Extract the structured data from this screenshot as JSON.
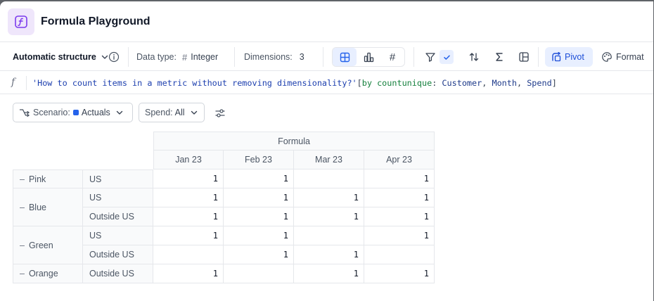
{
  "app": {
    "title": "Formula Playground",
    "icon": "formula-icon",
    "accent": "#7c3aed"
  },
  "toolbar": {
    "structure_label": "Automatic structure",
    "data_type_label": "Data type:",
    "data_type_value": "Integer",
    "dimensions_label": "Dimensions:",
    "dimensions_value": "3",
    "pivot_label": "Pivot",
    "format_label": "Format",
    "active_color": "#2563eb"
  },
  "formula": {
    "string_part": "'How to count items in a metric without removing dimensionality?'",
    "open_bracket": "[",
    "keyword": "by countunique",
    "colon": ":",
    "dims": [
      "Customer",
      "Month",
      "Spend"
    ],
    "comma": ", ",
    "close_bracket": "]"
  },
  "filters": {
    "scenario_label": "Scenario:",
    "scenario_value": "Actuals",
    "spend_label": "Spend:",
    "spend_value": "All"
  },
  "table": {
    "group_header": "Formula",
    "columns": [
      "Jan 23",
      "Feb 23",
      "Mar 23",
      "Apr 23"
    ],
    "groups": [
      {
        "name": "Pink",
        "rows": [
          {
            "region": "US",
            "values": [
              "1",
              "1",
              "",
              "1"
            ]
          }
        ]
      },
      {
        "name": "Blue",
        "rows": [
          {
            "region": "US",
            "values": [
              "1",
              "1",
              "1",
              "1"
            ]
          },
          {
            "region": "Outside US",
            "values": [
              "1",
              "1",
              "1",
              "1"
            ]
          }
        ]
      },
      {
        "name": "Green",
        "rows": [
          {
            "region": "US",
            "values": [
              "1",
              "1",
              "",
              "1"
            ]
          },
          {
            "region": "Outside US",
            "values": [
              "",
              "1",
              "1",
              ""
            ]
          }
        ]
      },
      {
        "name": "Orange",
        "rows": [
          {
            "region": "Outside US",
            "values": [
              "1",
              "",
              "1",
              "1"
            ]
          }
        ]
      }
    ]
  }
}
